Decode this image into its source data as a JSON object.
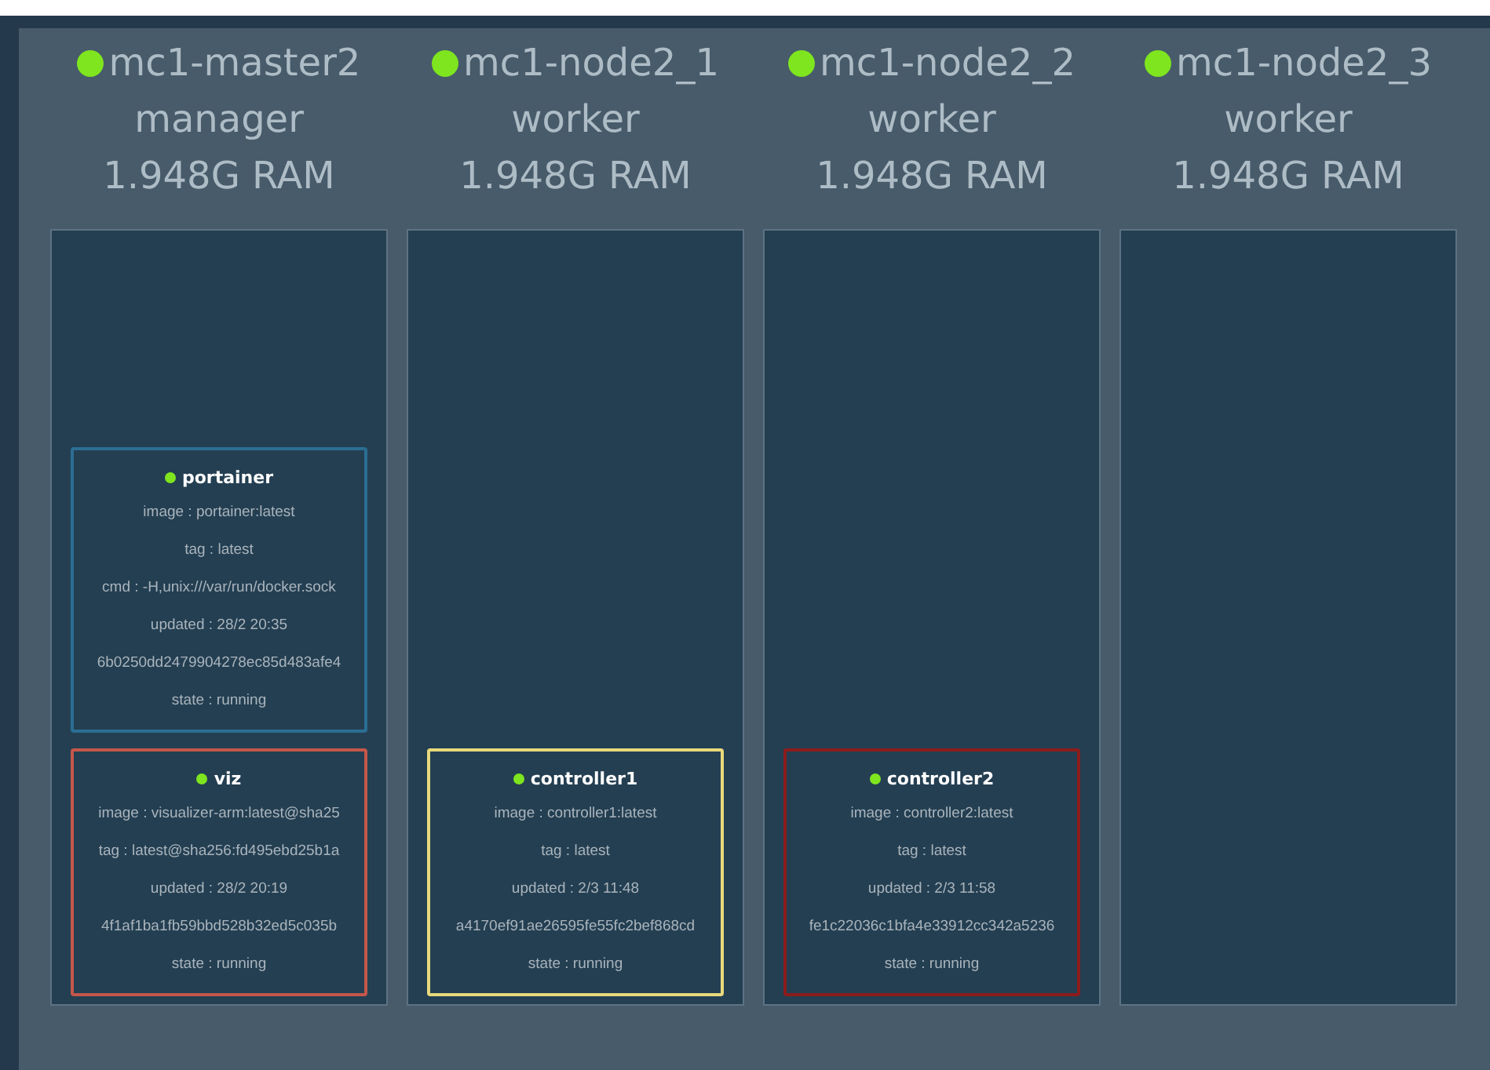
{
  "nodes": [
    {
      "name": "mc1-master2",
      "role": "manager",
      "ram": "1.948G RAM",
      "services": [
        {
          "name": "portainer",
          "color": "#2b6e94",
          "lines": [
            "image : portainer:latest",
            "tag : latest",
            "cmd : -H,unix:///var/run/docker.sock",
            "updated : 28/2 20:35",
            "6b0250dd2479904278ec85d483afe4",
            "state : running"
          ]
        },
        {
          "name": "viz",
          "color": "#c4574a",
          "lines": [
            "image : visualizer-arm:latest@sha25",
            "tag : latest@sha256:fd495ebd25b1a",
            "updated : 28/2 20:19",
            "4f1af1ba1fb59bbd528b32ed5c035b",
            "state : running"
          ]
        }
      ]
    },
    {
      "name": "mc1-node2_1",
      "role": "worker",
      "ram": "1.948G RAM",
      "services": [
        {
          "name": "controller1",
          "color": "#e8d97c",
          "lines": [
            "image : controller1:latest",
            "tag : latest",
            "updated : 2/3 11:48",
            "a4170ef91ae26595fe55fc2bef868cd",
            "state : running"
          ]
        }
      ]
    },
    {
      "name": "mc1-node2_2",
      "role": "worker",
      "ram": "1.948G RAM",
      "services": [
        {
          "name": "controller2",
          "color": "#8c1c1c",
          "lines": [
            "image : controller2:latest",
            "tag : latest",
            "updated : 2/3 11:58",
            "fe1c22036c1bfa4e33912cc342a5236",
            "state : running"
          ]
        }
      ]
    },
    {
      "name": "mc1-node2_3",
      "role": "worker",
      "ram": "1.948G RAM"
    }
  ]
}
